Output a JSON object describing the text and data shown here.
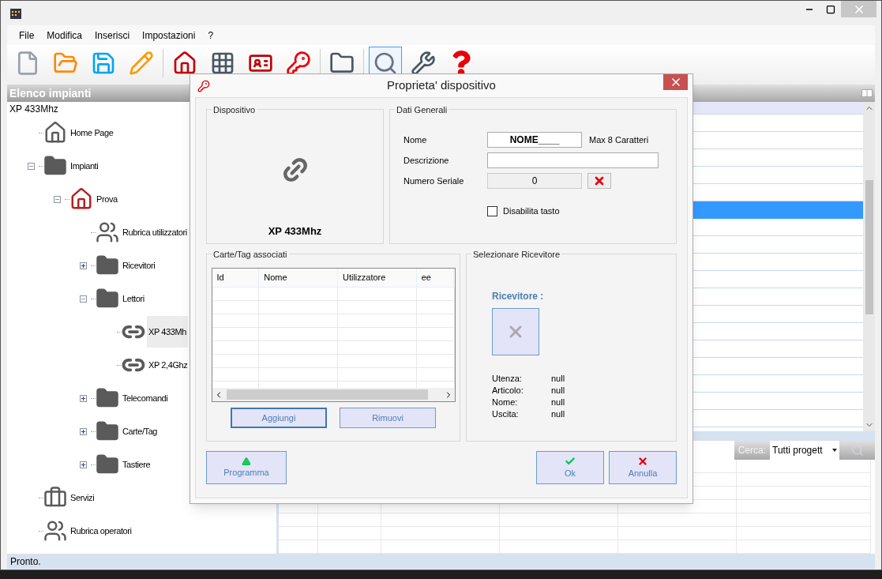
{
  "menu": [
    "File",
    "Modifica",
    "Inserisci",
    "Impostazioni",
    "?"
  ],
  "toolbar": [
    {
      "kind": "new",
      "selected": false
    },
    {
      "kind": "open",
      "selected": false
    },
    {
      "kind": "save",
      "selected": false
    },
    {
      "kind": "edit",
      "selected": false
    },
    {
      "kind": "sep"
    },
    {
      "kind": "home",
      "selected": false
    },
    {
      "kind": "keypad",
      "selected": false
    },
    {
      "kind": "card",
      "selected": false
    },
    {
      "kind": "key",
      "selected": false
    },
    {
      "kind": "sep"
    },
    {
      "kind": "folder",
      "selected": false
    },
    {
      "kind": "sep"
    },
    {
      "kind": "search",
      "selected": true
    },
    {
      "kind": "wrench",
      "selected": false
    },
    {
      "kind": "help",
      "selected": false
    }
  ],
  "left_panel": {
    "title": "Elenco impianti",
    "current": "XP 433Mhz",
    "tree": [
      {
        "label": "Home Page",
        "kind": "home",
        "selected": false
      },
      {
        "label": "Impianti",
        "kind": "folder",
        "selected": false,
        "expanded": true,
        "children": [
          {
            "label": "Prova",
            "kind": "site",
            "selected": false,
            "expanded": true,
            "children": [
              {
                "label": "Rubrica utilizzatori",
                "kind": "users",
                "selected": false
              },
              {
                "label": "Ricevitori",
                "kind": "folder",
                "selected": false,
                "expanded": false
              },
              {
                "label": "Lettori",
                "kind": "folder",
                "selected": false,
                "expanded": true,
                "children": [
                  {
                    "label": "XP 433Mh",
                    "kind": "link",
                    "selected": true
                  },
                  {
                    "label": "XP 2,4Ghz",
                    "kind": "link",
                    "selected": false
                  }
                ]
              },
              {
                "label": "Telecomandi",
                "kind": "folder",
                "selected": false,
                "expanded": false
              },
              {
                "label": "Carte/Tag",
                "kind": "folder",
                "selected": false,
                "expanded": false
              },
              {
                "label": "Tastiere",
                "kind": "folder",
                "selected": false,
                "expanded": false
              }
            ]
          }
        ]
      },
      {
        "label": "Servizi",
        "kind": "toolbox",
        "selected": false
      },
      {
        "label": "Rubrica operatori",
        "kind": "users",
        "selected": false
      }
    ]
  },
  "upper_grid": {
    "rows": [
      {
        "selected": false
      },
      {
        "selected": false
      },
      {
        "selected": false
      },
      {
        "selected": false
      },
      {
        "selected": false
      },
      {
        "selected": true
      },
      {
        "selected": false
      },
      {
        "selected": false
      },
      {
        "selected": false
      },
      {
        "selected": false
      },
      {
        "selected": false
      },
      {
        "selected": false
      },
      {
        "selected": false
      },
      {
        "selected": false
      },
      {
        "selected": false
      },
      {
        "selected": false
      },
      {
        "selected": false
      },
      {
        "selected": false
      }
    ]
  },
  "search": {
    "label": "Cerca:",
    "value": "Tutti progett"
  },
  "status_bar": "Pronto.",
  "dialog": {
    "title": "Proprieta' dispositivo",
    "device": {
      "legend": "Dispositivo",
      "name": "XP 433Mhz"
    },
    "general": {
      "legend": "Dati Generali",
      "name_label": "Nome",
      "name_value": "NOME____",
      "name_hint": "Max 8 Caratteri",
      "description_label": "Descrizione",
      "serial_label": "Numero Seriale",
      "serial_value": "0",
      "disable_label": "Disabilita tasto",
      "disable_checked": false
    },
    "cards": {
      "legend": "Carte/Tag associati",
      "columns": [
        "Id",
        "Nome",
        "Utilizzatore",
        "ee"
      ],
      "add": "Aggiungi",
      "remove": "Rimuovi"
    },
    "receiver": {
      "legend": "Selezionare Ricevitore",
      "label": "Ricevitore :",
      "info": [
        {
          "key": "Utenza:",
          "value": "null"
        },
        {
          "key": "Articolo:",
          "value": "null"
        },
        {
          "key": "Nome:",
          "value": "null"
        },
        {
          "key": "Uscita:",
          "value": "null"
        }
      ]
    },
    "buttons": {
      "program": "Programma",
      "ok": "Ok",
      "cancel": "Annulla"
    }
  }
}
